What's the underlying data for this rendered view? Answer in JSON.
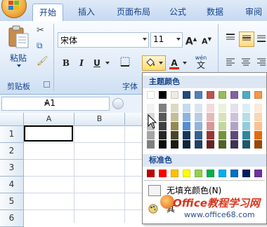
{
  "tabs": [
    {
      "label": "开始",
      "active": true
    },
    {
      "label": "插入"
    },
    {
      "label": "页面布局"
    },
    {
      "label": "公式"
    },
    {
      "label": "数据"
    },
    {
      "label": "审阅"
    }
  ],
  "clipboard": {
    "paste_label": "粘贴",
    "group_label": "剪贴板"
  },
  "font": {
    "name": "宋体",
    "size": "11",
    "group_label": "字体",
    "bold": "B",
    "italic": "I",
    "underline": "U",
    "wen": "wén",
    "wen_glyph": "文"
  },
  "namebox": {
    "value": "A1"
  },
  "sheet": {
    "columns": [
      "A",
      "B"
    ],
    "rows": [
      "1",
      "2",
      "3",
      "4",
      "5",
      "6"
    ]
  },
  "picker": {
    "theme_header": "主题颜色",
    "standard_header": "标准色",
    "no_fill": "无填充颜色(N)",
    "more_colors_partial": "其",
    "theme_top": [
      "#ffffff",
      "#000000",
      "#eeece1",
      "#1f497d",
      "#4f81bd",
      "#c0504d",
      "#9bbb59",
      "#8064a2",
      "#4bacc6",
      "#f79646"
    ],
    "theme_columns": [
      [
        "#f2f2f2",
        "#d8d8d8",
        "#bfbfbf",
        "#a5a5a5",
        "#7f7f7f"
      ],
      [
        "#7f7f7f",
        "#595959",
        "#3f3f3f",
        "#262626",
        "#0c0c0c"
      ],
      [
        "#ddd9c3",
        "#c4bd97",
        "#938953",
        "#494429",
        "#1d1b10"
      ],
      [
        "#c6d9f0",
        "#8db3e2",
        "#548dd4",
        "#17365d",
        "#0f243e"
      ],
      [
        "#dbe5f1",
        "#b8cce4",
        "#95b3d7",
        "#366092",
        "#244061"
      ],
      [
        "#f2dcdb",
        "#e5b9b7",
        "#d99694",
        "#953734",
        "#632423"
      ],
      [
        "#ebf1dd",
        "#d7e3bc",
        "#c3d69b",
        "#76923c",
        "#4f6128"
      ],
      [
        "#e5e0ec",
        "#ccc1d9",
        "#b2a2c7",
        "#5f497a",
        "#3f3151"
      ],
      [
        "#dbeef3",
        "#b7dde8",
        "#92cddc",
        "#31859b",
        "#205867"
      ],
      [
        "#fdeada",
        "#fbd5b5",
        "#fac08f",
        "#e36c09",
        "#974806"
      ]
    ],
    "standard": [
      "#c00000",
      "#ff0000",
      "#ffc000",
      "#ffff00",
      "#92d050",
      "#00b050",
      "#00b0f0",
      "#0070c0",
      "#002060",
      "#7030a0"
    ]
  },
  "watermark": {
    "brand": "Office教程学习网",
    "url": "www.office68.com"
  },
  "colors": {
    "accent": "#15428b",
    "fill_highlight": "#ffd97a"
  }
}
